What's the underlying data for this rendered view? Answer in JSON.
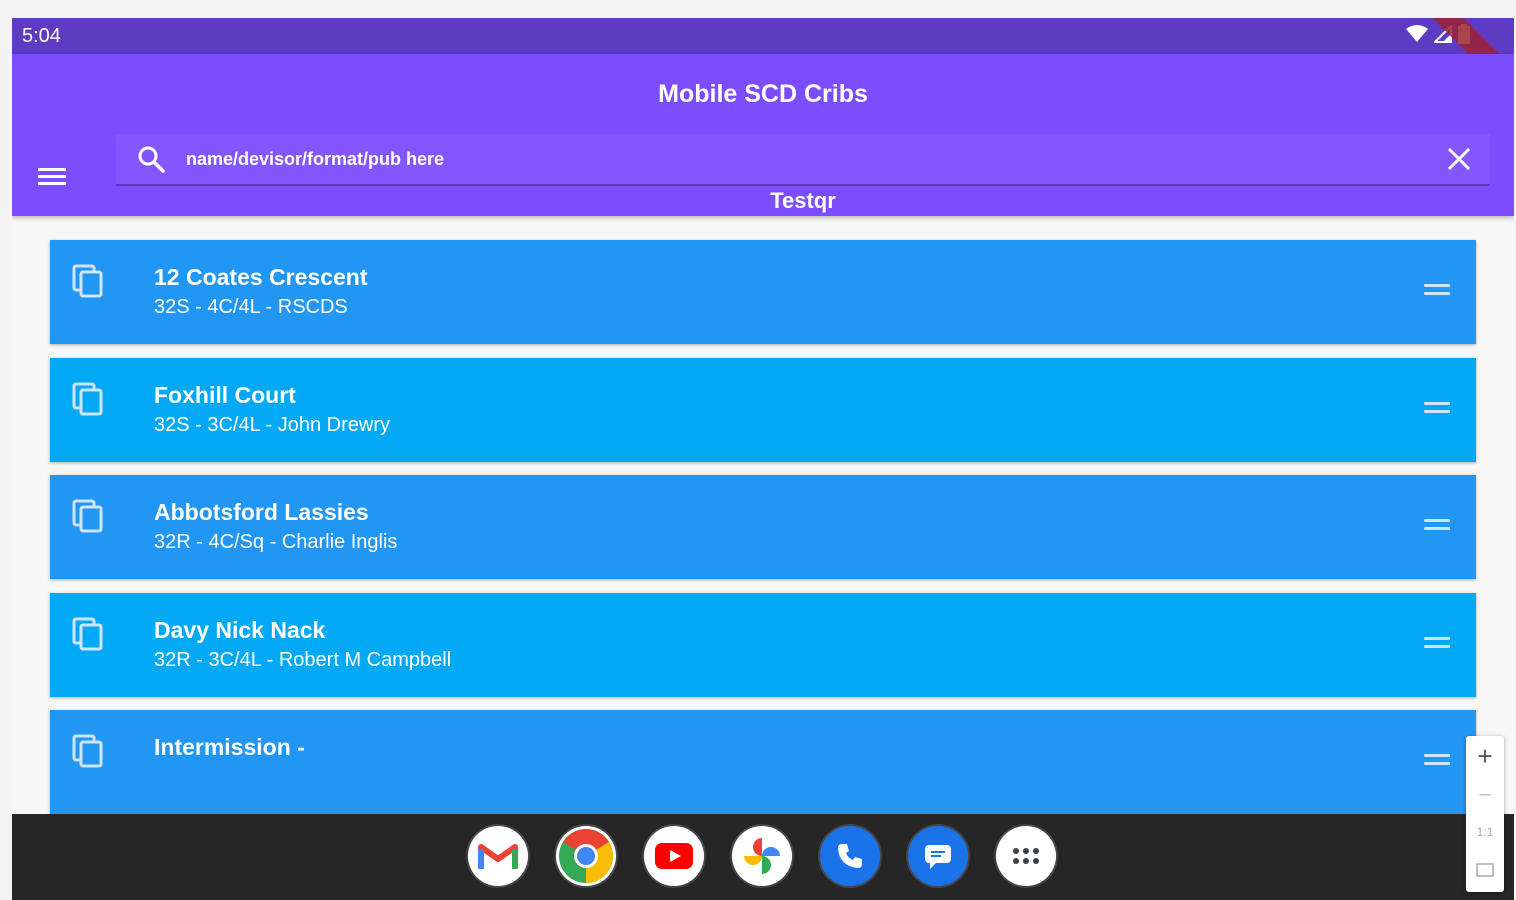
{
  "status_bar": {
    "time": "5:04",
    "icons": [
      "wifi-icon",
      "signal-icon",
      "battery-icon"
    ],
    "color": "#5e3bc3"
  },
  "app_bar": {
    "title": "Mobile SCD Cribs",
    "search_placeholder": "name/devisor/format/pub here",
    "subtitle": "Testqr",
    "color": "#7c4dff"
  },
  "dances": [
    {
      "title": "12 Coates Crescent",
      "details": "32S - 4C/4L - RSCDS",
      "color": "#2196f3"
    },
    {
      "title": "Foxhill Court",
      "details": "32S - 3C/4L - John Drewry",
      "color": "#03a9f4"
    },
    {
      "title": "Abbotsford Lassies",
      "details": "32R - 4C/Sq - Charlie Inglis",
      "color": "#2196f3"
    },
    {
      "title": "Davy Nick Nack",
      "details": "32R - 3C/4L - Robert M Campbell",
      "color": "#03a9f4"
    },
    {
      "title": "Intermission -",
      "details": "",
      "color": "#2196f3"
    }
  ],
  "dock": {
    "apps": [
      "gmail-icon",
      "chrome-icon",
      "youtube-icon",
      "photos-icon",
      "phone-icon",
      "messages-icon",
      "app-drawer-icon"
    ],
    "color": "#262626"
  },
  "zoom": {
    "plus": "+",
    "minus": "–",
    "ratio": "1:1"
  }
}
